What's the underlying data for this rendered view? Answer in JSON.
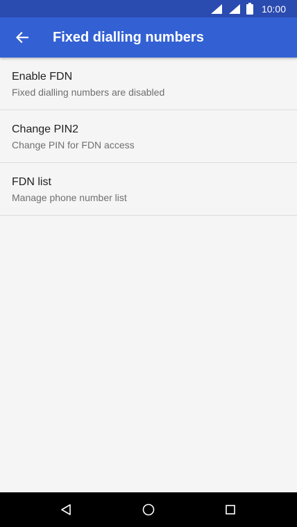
{
  "status_bar": {
    "time": "10:00",
    "icons": [
      "wifi-signal-icon",
      "cell-signal-icon",
      "battery-icon"
    ]
  },
  "app_bar": {
    "back_icon": "arrow-left-icon",
    "title": "Fixed dialling numbers",
    "color": "#3361d3",
    "status_color": "#2a4bb0"
  },
  "settings": {
    "items": [
      {
        "title": "Enable FDN",
        "subtitle": "Fixed dialling numbers are disabled"
      },
      {
        "title": "Change PIN2",
        "subtitle": "Change PIN for FDN access"
      },
      {
        "title": "FDN list",
        "subtitle": "Manage phone number list"
      }
    ]
  },
  "nav_bar": {
    "buttons": [
      "back-triangle-icon",
      "home-circle-icon",
      "recents-square-icon"
    ]
  }
}
